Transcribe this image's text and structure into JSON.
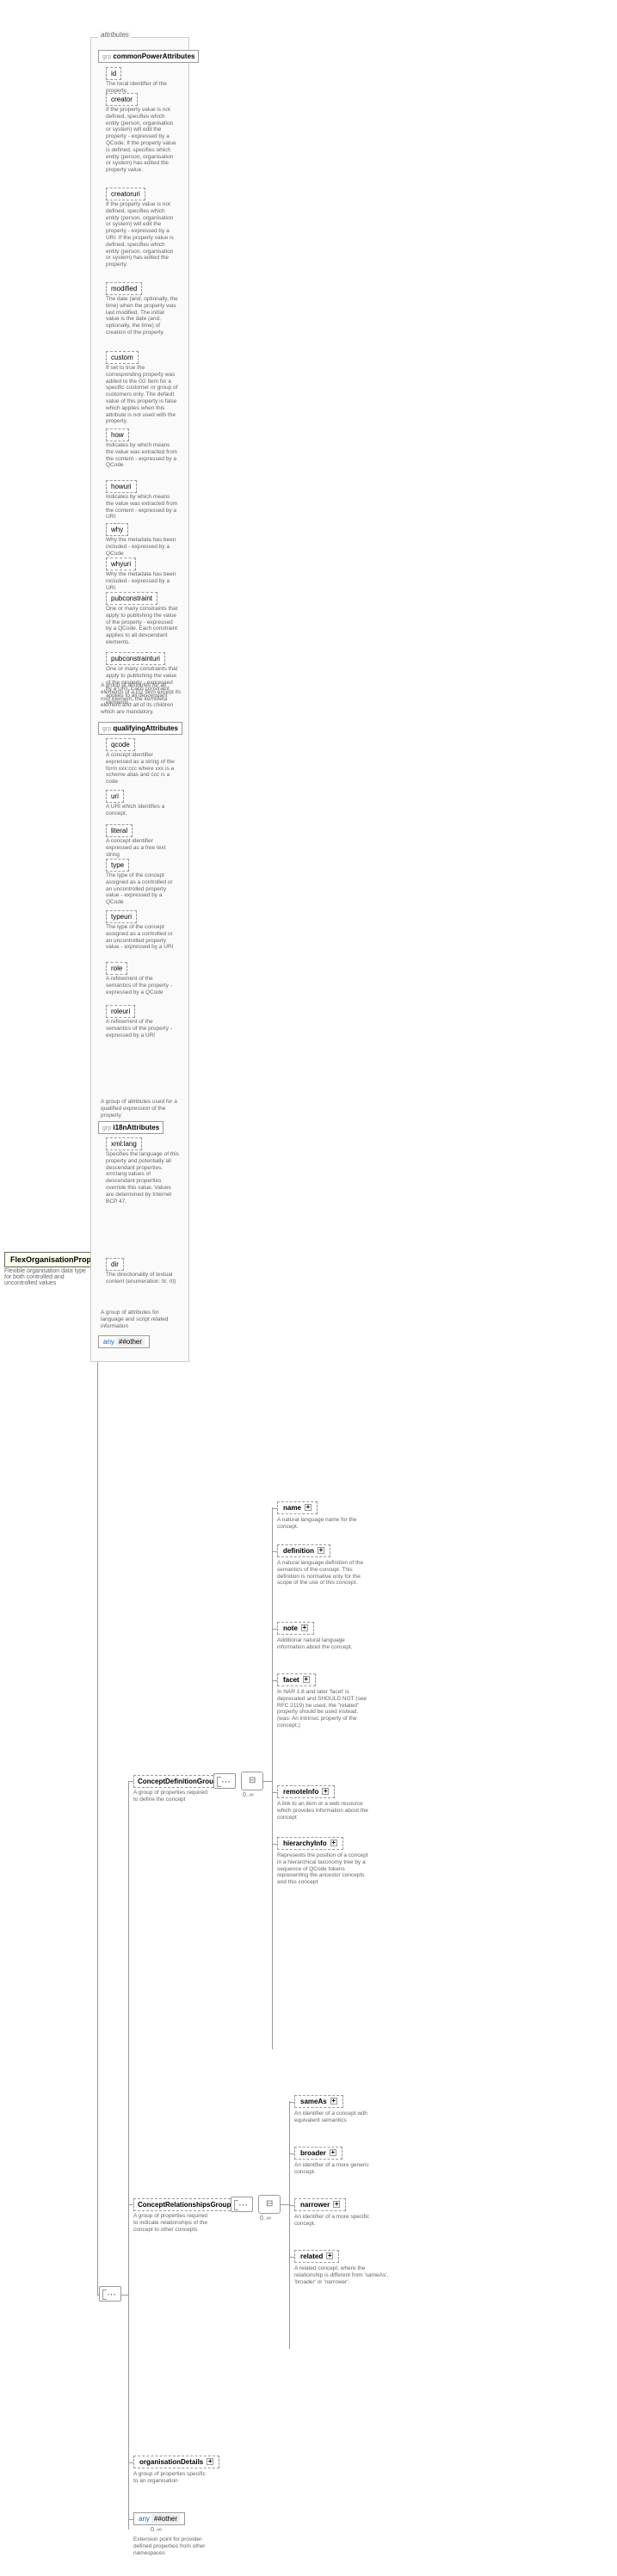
{
  "root": {
    "name": "FlexOrganisationPropType",
    "desc": "Flexible organisation data type for both controlled and uncontrolled values"
  },
  "attributes_label": "attributes",
  "groups": {
    "common": {
      "prefix": "grp",
      "name": "commonPowerAttributes",
      "desc": "A group of attributes for all elements of a G2 Item except its root element, the itemMeta element and all of its children which are mandatory.",
      "items": [
        {
          "name": "id",
          "desc": "The local identifier of the property."
        },
        {
          "name": "creator",
          "desc": "If the property value is not defined, specifies which entity (person, organisation or system) will edit the property - expressed by a QCode. If the property value is defined, specifies which entity (person, organisation or system) has edited the property value."
        },
        {
          "name": "creatoruri",
          "desc": "If the property value is not defined, specifies which entity (person, organisation or system) will edit the property - expressed by a URI. If the property value is defined, specifies which entity (person, organisation or system) has edited the property."
        },
        {
          "name": "modified",
          "desc": "The date (and, optionally, the time) when the property was last modified. The initial value is the date (and, optionally, the time) of creation of the property."
        },
        {
          "name": "custom",
          "desc": "If set to true the corresponding property was added to the G2 Item for a specific customer or group of customers only. The default value of this property is false which applies when this attribute is not used with the property."
        },
        {
          "name": "how",
          "desc": "Indicates by which means the value was extracted from the content - expressed by a QCode"
        },
        {
          "name": "howuri",
          "desc": "Indicates by which means the value was extracted from the content - expressed by a URI"
        },
        {
          "name": "why",
          "desc": "Why the metadata has been included - expressed by a QCode"
        },
        {
          "name": "whyuri",
          "desc": "Why the metadata has been included - expressed by a URI"
        },
        {
          "name": "pubconstraint",
          "desc": "One or many constraints that apply to publishing the value of the property - expressed by a QCode. Each constraint applies to all descendant elements."
        },
        {
          "name": "pubconstrainturi",
          "desc": "One or many constraints that apply to publishing the value of the property - expressed by a URI. Each constraint applies to all descendant elements."
        }
      ]
    },
    "qualifying": {
      "prefix": "grp",
      "name": "qualifyingAttributes",
      "desc": "A group of attributes used for a qualified expression of the property",
      "items": [
        {
          "name": "qcode",
          "desc": "A concept identifier expressed as a string of the form xxx:ccc where xxx is a scheme alias and ccc is a code"
        },
        {
          "name": "uri",
          "desc": "A URI which identifies a concept."
        },
        {
          "name": "literal",
          "desc": "A concept identifier expressed as a free text string"
        },
        {
          "name": "type",
          "desc": "The type of the concept assigned as a controlled or an uncontrolled property value - expressed by a QCode"
        },
        {
          "name": "typeuri",
          "desc": "The type of the concept assigned as a controlled or an uncontrolled property value - expressed by a URI"
        },
        {
          "name": "role",
          "desc": "A refinement of the semantics of the property - expressed by a QCode"
        },
        {
          "name": "roleuri",
          "desc": "A refinement of the semantics of the property - expressed by a URI"
        }
      ]
    },
    "i18n": {
      "prefix": "grp",
      "name": "i18nAttributes",
      "desc": "A group of attributes for language and script related information",
      "items": [
        {
          "name": "xml:lang",
          "desc": "Specifies the language of this property and potentially all descendant properties. xml:lang values of descendant properties override this value. Values are determined by Internet BCP 47."
        },
        {
          "name": "dir",
          "desc": "The directionality of textual content (enumeration: ltr, rtl)"
        }
      ]
    }
  },
  "any_attr": {
    "label": "any",
    "ns": "##other"
  },
  "concept_def": {
    "name": "ConceptDefinitionGroup",
    "desc": "A group of properties required to define the concept",
    "card": "0..∞",
    "items": [
      {
        "name": "name",
        "desc": "A natural language name for the concept."
      },
      {
        "name": "definition",
        "desc": "A natural language definition of the semantics of the concept. This definition is normative only for the scope of the use of this concept."
      },
      {
        "name": "note",
        "desc": "Additional natural language information about the concept."
      },
      {
        "name": "facet",
        "desc": "In NAR 1.8 and later 'facet' is deprecated and SHOULD NOT (see RFC 2119) be used, the \"related\" property should be used instead. (was: An intrinsic property of the concept.)"
      },
      {
        "name": "remoteInfo",
        "desc": "A link to an item or a web resource which provides information about the concept"
      },
      {
        "name": "hierarchyInfo",
        "desc": "Represents the position of a concept in a hierarchical taxonomy tree by a sequence of QCode tokens representing the ancestor concepts and this concept"
      }
    ]
  },
  "concept_rel": {
    "name": "ConceptRelationshipsGroup",
    "desc": "A group of properties required to indicate relationships of the concept to other concepts",
    "card": "0..∞",
    "items": [
      {
        "name": "sameAs",
        "desc": "An identifier of a concept with equivalent semantics"
      },
      {
        "name": "broader",
        "desc": "An identifier of a more generic concept."
      },
      {
        "name": "narrower",
        "desc": "An identifier of a more specific concept."
      },
      {
        "name": "related",
        "desc": "A related concept, where the relationship is different from 'sameAs', 'broader' or 'narrower'."
      }
    ]
  },
  "org_details": {
    "name": "organisationDetails",
    "desc": "A group of properties specific to an organisation"
  },
  "any_elem": {
    "label": "any",
    "ns": "##other",
    "card": "0..∞",
    "desc": "Extension point for provider-defined properties from other namespaces"
  }
}
